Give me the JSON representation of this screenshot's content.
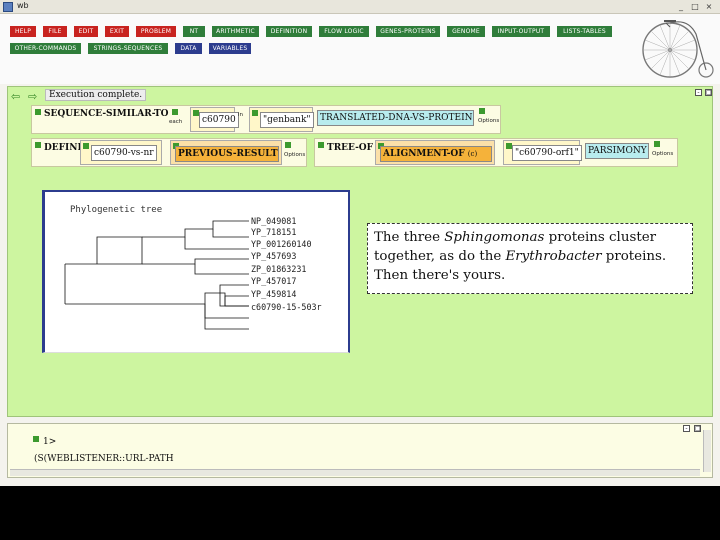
{
  "window": {
    "title": "wb"
  },
  "menu": [
    {
      "label": "HELP",
      "style": "red"
    },
    {
      "label": "FILE",
      "style": "red"
    },
    {
      "label": "EDIT",
      "style": "red"
    },
    {
      "label": "EXIT",
      "style": "red"
    },
    {
      "label": "PROBLEM",
      "style": "red"
    },
    {
      "label": "NT",
      "style": "green"
    },
    {
      "label": "ARITHMETIC",
      "style": "green"
    },
    {
      "label": "DEFINITION",
      "style": "green"
    },
    {
      "label": "FLOW LOGIC",
      "style": "green"
    },
    {
      "label": "GENES-PROTEINS",
      "style": "green"
    },
    {
      "label": "GENOME",
      "style": "green"
    },
    {
      "label": "INPUT-OUTPUT",
      "style": "green"
    },
    {
      "label": "LISTS-TABLES",
      "style": "green"
    },
    {
      "label": "OTHER-COMMANDS",
      "style": "green"
    },
    {
      "label": "STRINGS-SEQUENCES",
      "style": "green"
    },
    {
      "label": "DATA",
      "style": "blue"
    },
    {
      "label": "VARIABLES",
      "style": "blue"
    }
  ],
  "workspace": {
    "status": "Execution complete.",
    "row1": {
      "keyword": "SEQUENCE-SIMILAR-TO",
      "each_label": "each",
      "field1": "c60790",
      "in_label": "in",
      "field2": "\"genbank\"",
      "keyword2": "TRANSLATED-DNA-VS-PROTEIN",
      "options_label": "Options"
    },
    "row2": {
      "keyword": "DEFINE",
      "field1": "c60790-vs-nr",
      "keyword2": "PREVIOUS-RESULT",
      "options_label": "Options",
      "keyword3": "TREE-OF",
      "keyword4": "ALIGNMENT-OF",
      "paren_label": "(c)",
      "field2": "\"c60790-orf1\"",
      "keyword5": "PARSIMONY",
      "options_label2": "Options"
    },
    "tree": {
      "title": "Phylogenetic tree",
      "leaves": [
        "NP_049081",
        "YP_718151",
        "YP_001260140",
        "YP_457693",
        "ZP_01863231",
        "YP_457017",
        "YP_459814",
        "c60790-15-503r"
      ]
    },
    "note": {
      "part1": "The three ",
      "italic1": "Sphingomonas",
      "part2": " proteins cluster together, as do the ",
      "italic2": "Erythrobacter",
      "part3": " proteins. Then there's yours."
    }
  },
  "console": {
    "prompt": "1>",
    "text": "(S(WEBLISTENER::URL-PATH"
  },
  "colors": {
    "workspace_bg": "#cdf5a0",
    "menu_red": "#c8231f",
    "menu_green": "#2f7d3a",
    "menu_blue": "#2c3c8e",
    "highlight_orange": "#f5b23a",
    "highlight_cyan": "#b8ecee"
  }
}
